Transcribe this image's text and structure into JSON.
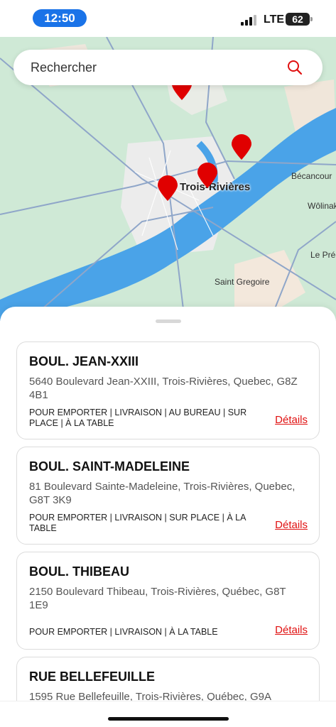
{
  "status_bar": {
    "time": "12:50",
    "network": "LTE",
    "battery": "62"
  },
  "search": {
    "placeholder": "Rechercher",
    "icon": "search-icon"
  },
  "map": {
    "city_label": "Trois-Rivières",
    "labels": [
      "Bécancour",
      "Wôlinak",
      "Le Préc",
      "Saint Gregoire"
    ]
  },
  "locations": [
    {
      "name": "BOUL. JEAN-XXIII",
      "address": "5640 Boulevard Jean-XXIII, Trois-Rivières, Quebec, G8Z 4B1",
      "services": "POUR EMPORTER | LIVRAISON | AU BUREAU | SUR PLACE | À LA TABLE",
      "details": "Détails"
    },
    {
      "name": "BOUL. SAINT-MADELEINE",
      "address": "81 Boulevard Sainte-Madeleine, Trois-Rivières, Quebec, G8T 3K9",
      "services": "POUR EMPORTER | LIVRAISON | SUR PLACE | À LA TABLE",
      "details": "Détails"
    },
    {
      "name": "BOUL. THIBEAU",
      "address": "2150 Boulevard Thibeau, Trois-Rivières, Québec, G8T 1E9",
      "services": "POUR EMPORTER | LIVRAISON | À LA TABLE",
      "details": "Détails"
    },
    {
      "name": "RUE BELLEFEUILLE",
      "address": "1595 Rue Bellefeuille, Trois-Rivières, Québec, G9A",
      "services": "",
      "details": ""
    }
  ],
  "colors": {
    "accent": "#e01010",
    "time_pill": "#1a73e8",
    "water": "#4aa3e8",
    "land": "#cfe9d6"
  }
}
